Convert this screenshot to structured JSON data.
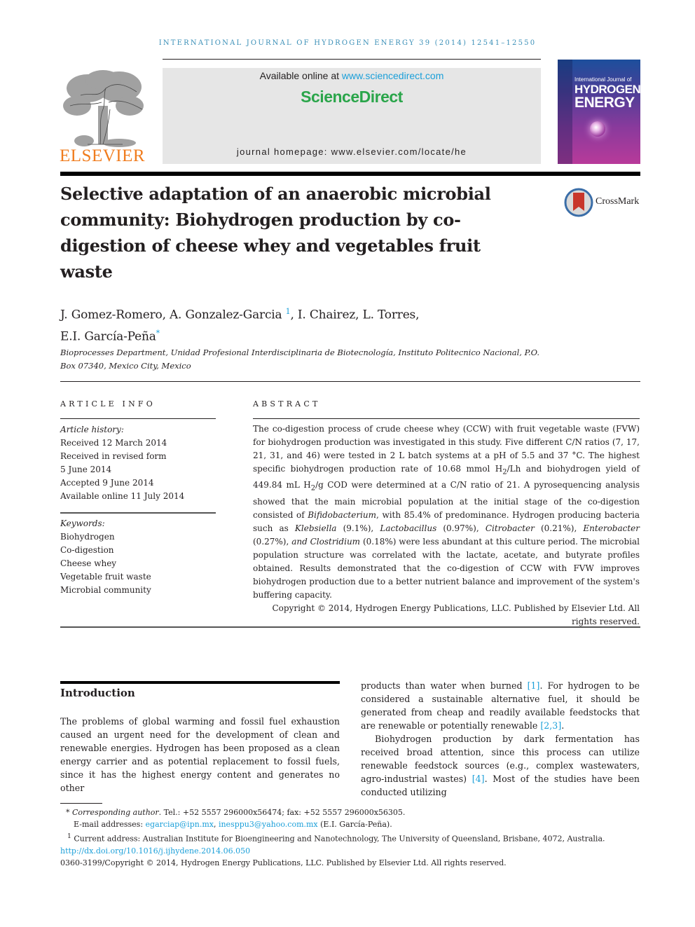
{
  "header": {
    "running_head": "INTERNATIONAL JOURNAL OF HYDROGEN ENERGY 39 (2014) 12541–12550",
    "publisher_logo_label": "ELSEVIER",
    "available_online_prefix": "Available online at ",
    "available_online_link": "www.sciencedirect.com",
    "sciencedirect_label": "ScienceDirect",
    "journal_homepage": "journal homepage: www.elsevier.com/locate/he",
    "cover": {
      "line1": "International Journal of",
      "line2": "HYDROGEN",
      "line3": "ENERGY"
    }
  },
  "article": {
    "title": "Selective adaptation of an anaerobic microbial community: Biohydrogen production by co-digestion of cheese whey and vegetables fruit waste",
    "crossmark_label": "CrossMark",
    "authors_line1_a": "J. Gomez-Romero, A. Gonzalez-Garcia ",
    "authors_line1_sup": "1",
    "authors_line1_b": ", I. Chairez, L. Torres,",
    "authors_line2": "E.I. García-Peña",
    "authors_line2_sup": "*",
    "affiliation": "Bioprocesses Department, Unidad Profesional Interdisciplinaria de Biotecnología, Instituto Politecnico Nacional, P.O. Box 07340, Mexico City, Mexico"
  },
  "article_info": {
    "heading": "ARTICLE INFO",
    "history_label": "Article history:",
    "history": [
      "Received 12 March 2014",
      "Received in revised form",
      "5 June 2014",
      "Accepted 9 June 2014",
      "Available online 11 July 2014"
    ],
    "keywords_label": "Keywords:",
    "keywords": [
      "Biohydrogen",
      "Co-digestion",
      "Cheese whey",
      "Vegetable fruit waste",
      "Microbial community"
    ]
  },
  "abstract": {
    "heading": "ABSTRACT",
    "p1": "The co-digestion process of crude cheese whey (CCW) with fruit vegetable waste (FVW) for biohydrogen production was investigated in this study. Five different C/N ratios (7, 17, 21, 31, and 46) were tested in 2 L batch systems at a pH of 5.5 and 37 °C. The highest specific biohydrogen production rate of 10.68 mmol H",
    "sub1": "2",
    "p2": "/Lh and biohydrogen yield of 449.84 mL H",
    "sub2": "2",
    "p3": "/g COD were determined at a C/N ratio of 21. A pyrosequencing analysis showed that the main microbial population at the initial stage of the co-digestion consisted of ",
    "it_bifido": "Bifidobacterium",
    "p4": ", with 85.4% of predominance. Hydrogen producing bacteria such as ",
    "it_klebsiella": "Klebsiella",
    "p5": " (9.1%), ",
    "it_lacto": "Lactobacillus",
    "p6": " (0.97%), ",
    "it_citro": "Citrobacter",
    "p7": " (0.21%), ",
    "it_entero": "Enterobacter",
    "p8": " (0.27%), ",
    "it_and_clostridium": "and Clostridium",
    "p9": " (0.18%) were less abundant at this culture period. The microbial population structure was correlated with the lactate, acetate, and butyrate profiles obtained. Results demonstrated that the co-digestion of CCW with FVW improves biohydrogen production due to a better nutrient balance and improvement of the system's buffering capacity.",
    "copyright": "Copyright © 2014, Hydrogen Energy Publications, LLC. Published by Elsevier Ltd. All rights reserved."
  },
  "introduction": {
    "heading": "Introduction",
    "left_p1": "The problems of global warming and fossil fuel exhaustion caused an urgent need for the development of clean and renewable energies. Hydrogen has been proposed as a clean energy carrier and as potential replacement to fossil fuels, since it has the highest energy content and generates no other",
    "right_a": "products than water when burned ",
    "cite1": "[1]",
    "right_b": ". For hydrogen to be considered a sustainable alternative fuel, it should be generated from cheap and readily available feedstocks that are renewable or potentially renewable ",
    "cite2": "[2,3]",
    "right_c": ".",
    "right_p2a": "Biohydrogen production by dark fermentation has received broad attention, since this process can utilize renewable feedstock sources (e.g., complex wastewaters, agro-industrial wastes) ",
    "cite3": "[4]",
    "right_p2b": ". Most of the studies have been conducted utilizing"
  },
  "footnotes": {
    "corr_mark": "* ",
    "corr_label": "Corresponding author",
    "corr_text": ". Tel.: +52 5557 296000x56474; fax: +52 5557 296000x56305.",
    "email_prefix": "E-mail addresses: ",
    "email1": "egarciap@ipn.mx",
    "email_sep": ", ",
    "email2": "inesppu3@yahoo.com.mx",
    "email_suffix": " (E.I. García-Peña).",
    "note1_mark": "1",
    "note1_text": " Current address: Australian Institute for Bioengineering and Nanotechnology, The University of Queensland, Brisbane, 4072, Australia.",
    "doi": "http://dx.doi.org/10.1016/j.ijhydene.2014.06.050",
    "issn_copyright": "0360-3199/Copyright © 2014, Hydrogen Energy Publications, LLC. Published by Elsevier Ltd. All rights reserved."
  }
}
